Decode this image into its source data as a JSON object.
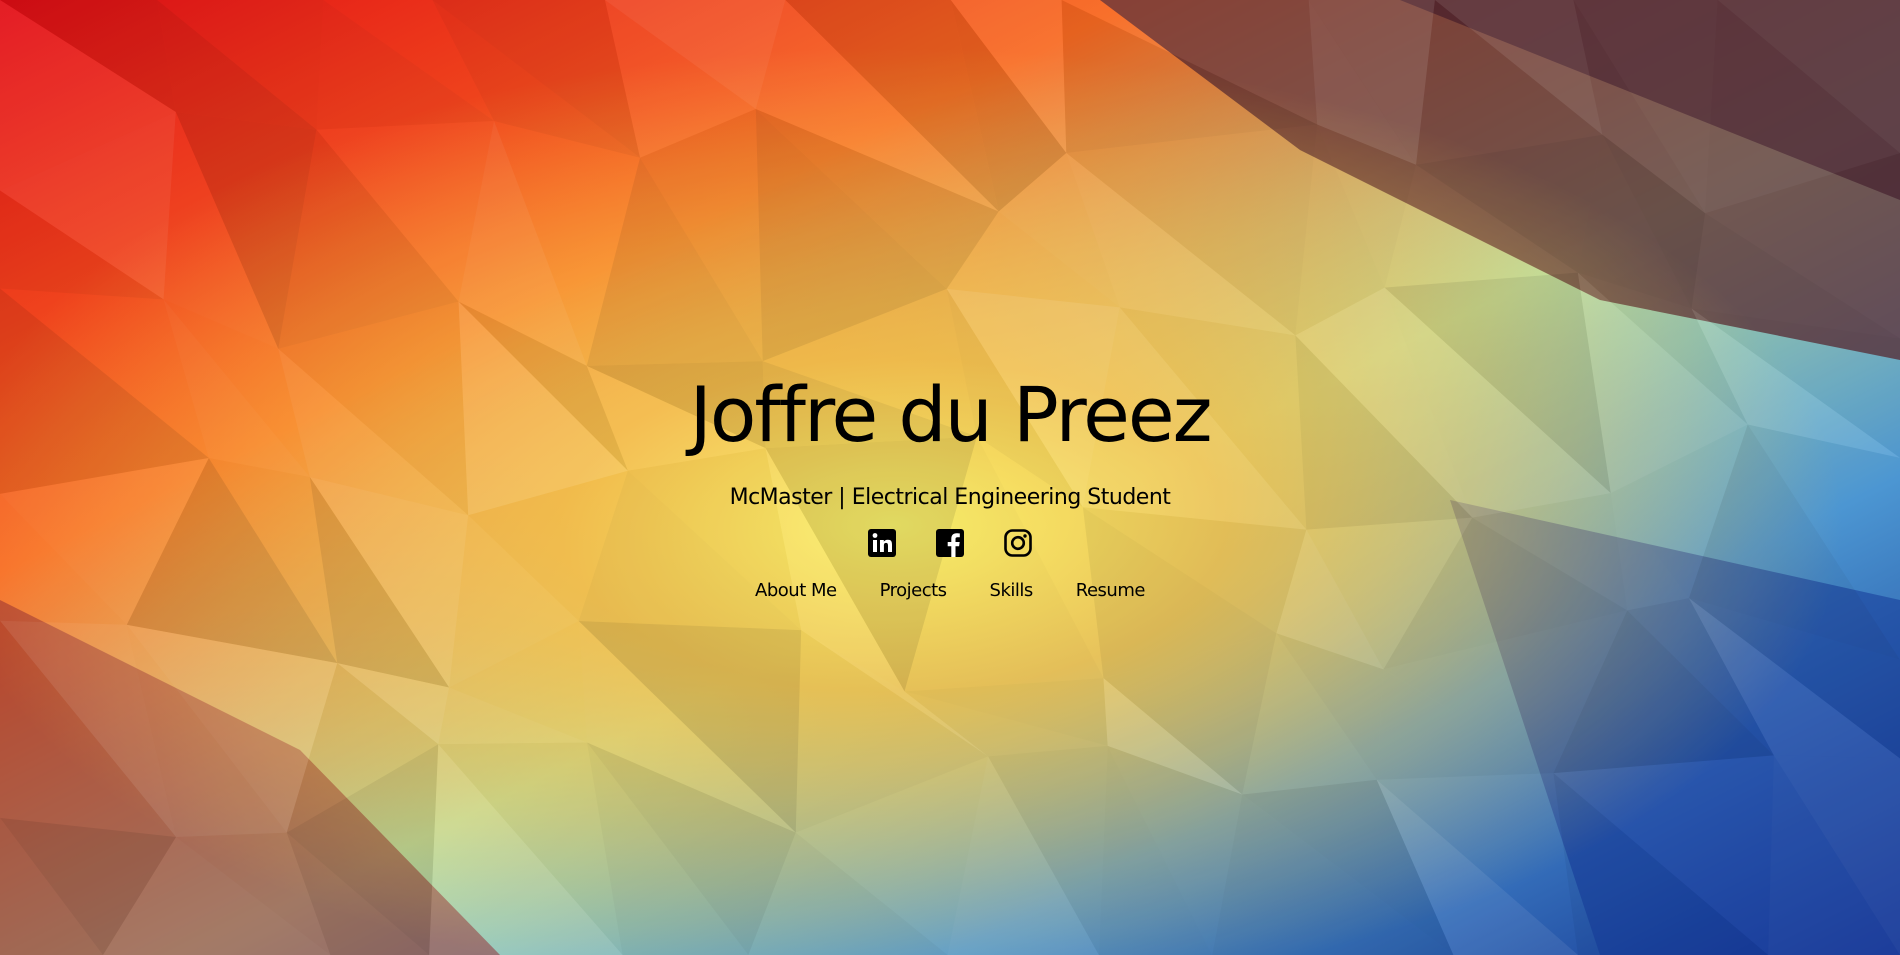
{
  "colors": {
    "text": "#000000",
    "gradient_top_left": "#e8111b",
    "gradient_center": "#fbf26e",
    "gradient_top_right": "#4a1c2c",
    "gradient_bottom_right": "#123a9e",
    "gradient_bottom_left": "#7a1a2a"
  },
  "hero": {
    "title": "Joffre du Preez",
    "subtitle": "McMaster | Electrical Engineering Student"
  },
  "socials": [
    {
      "icon": "linkedin-icon",
      "label": "LinkedIn"
    },
    {
      "icon": "facebook-icon",
      "label": "Facebook"
    },
    {
      "icon": "instagram-icon",
      "label": "Instagram"
    }
  ],
  "nav": {
    "items": [
      {
        "label": "About Me"
      },
      {
        "label": "Projects"
      },
      {
        "label": "Skills"
      },
      {
        "label": "Resume"
      }
    ]
  }
}
